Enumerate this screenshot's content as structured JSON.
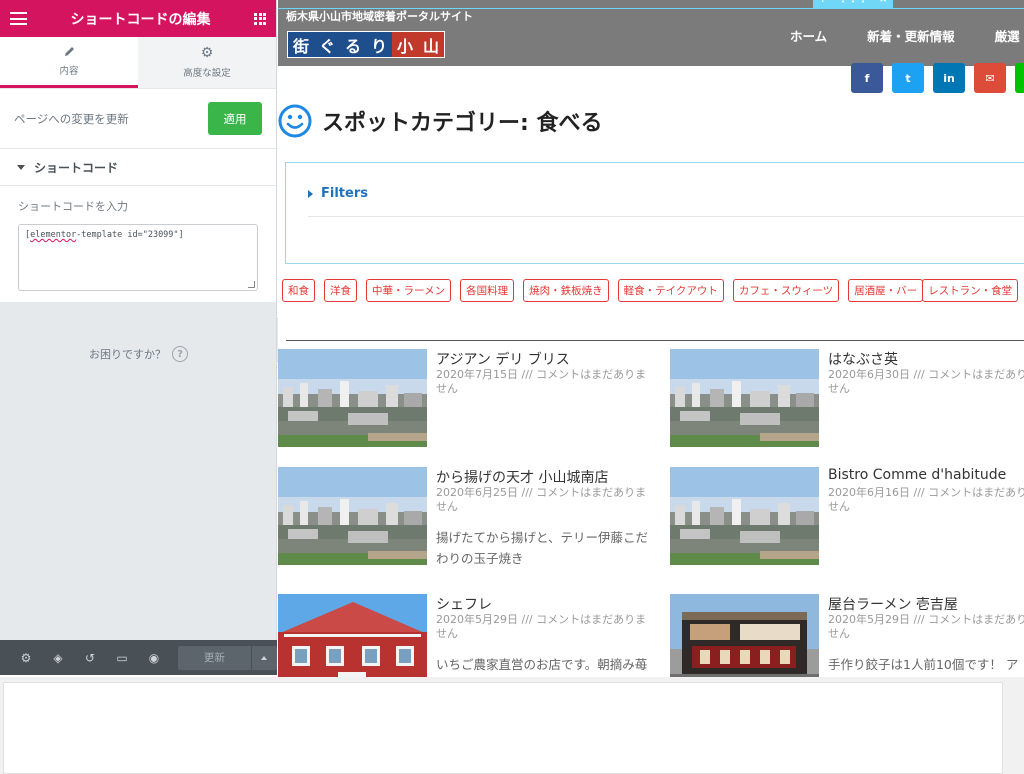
{
  "panel": {
    "title": "ショートコードの編集",
    "tabs": [
      {
        "label": "内容",
        "icon": "pencil-icon"
      },
      {
        "label": "高度な設定",
        "icon": "gear-icon"
      }
    ],
    "update_label": "ページへの変更を更新",
    "apply_label": "適用",
    "section_title": "ショートコード",
    "field_label": "ショートコードを入力",
    "shortcode_prefix": "[",
    "shortcode_word": "elementor",
    "shortcode_rest": "-template id=\"23099\"]",
    "help_label": "お困りですか？",
    "footer": {
      "icons": [
        "settings-icon",
        "layers-icon",
        "history-icon",
        "responsive-icon",
        "preview-eye-icon"
      ],
      "update_label": "更新"
    },
    "accent_color": "#d5145f"
  },
  "site": {
    "tagline": "栃木県小山市地域密着ポータルサイト",
    "logo_chars": [
      "街",
      "ぐ",
      "る",
      "り",
      "小",
      "山"
    ],
    "nav": [
      "ホーム",
      "新着・更新情報",
      "厳選"
    ],
    "edit_handle": [
      "+",
      "⋮⋮⋮",
      "×"
    ],
    "share": [
      {
        "icon": "facebook-icon",
        "glyph": "f",
        "color": "#3b5998"
      },
      {
        "icon": "twitter-icon",
        "glyph": "t",
        "color": "#1da1f2"
      },
      {
        "icon": "linkedin-icon",
        "glyph": "in",
        "color": "#0077b5"
      },
      {
        "icon": "email-icon",
        "glyph": "✉",
        "color": "#dd4b39"
      },
      {
        "icon": "line-icon",
        "glyph": "L",
        "color": "#00c300"
      }
    ]
  },
  "page": {
    "title": "スポットカテゴリー: 食べる",
    "filters_label": "Filters",
    "tags": [
      "和食",
      "洋食",
      "中華・ラーメン",
      "各国料理",
      "焼肉・鉄板焼き",
      "軽食・テイクアウト",
      "カフェ・スウィーツ",
      "居酒屋・バー",
      "レストラン・食堂"
    ]
  },
  "cards": [
    {
      "title": "アジアン デリ ブリス",
      "meta": "2020年7月15日 /// コメントはまだありません",
      "excerpt": "",
      "image": "city"
    },
    {
      "title": "はなぶさ英",
      "meta": "2020年6月30日 /// コメントはまだありません",
      "excerpt": "",
      "image": "city"
    },
    {
      "title": "から揚げの天才 小山城南店",
      "meta": "2020年6月25日 /// コメントはまだありません",
      "excerpt": "揚げたてから揚げと、テリー伊藤こだわりの玉子焼き",
      "image": "city"
    },
    {
      "title": "Bistro Comme d'habitude",
      "meta": "2020年6月16日 /// コメントはまだありません",
      "excerpt": "",
      "image": "city"
    },
    {
      "title": "シェフレ",
      "meta": "2020年5月29日 /// コメントはまだありません",
      "excerpt": "いちご農家直営のお店です。朝摘み苺がフレッシュなスイーツ",
      "image": "redhouse"
    },
    {
      "title": "屋台ラーメン 壱吉屋",
      "meta": "2020年5月29日 /// コメントはまだありません",
      "excerpt": "手作り餃子は1人前10個です！ ア",
      "image": "shop"
    }
  ]
}
